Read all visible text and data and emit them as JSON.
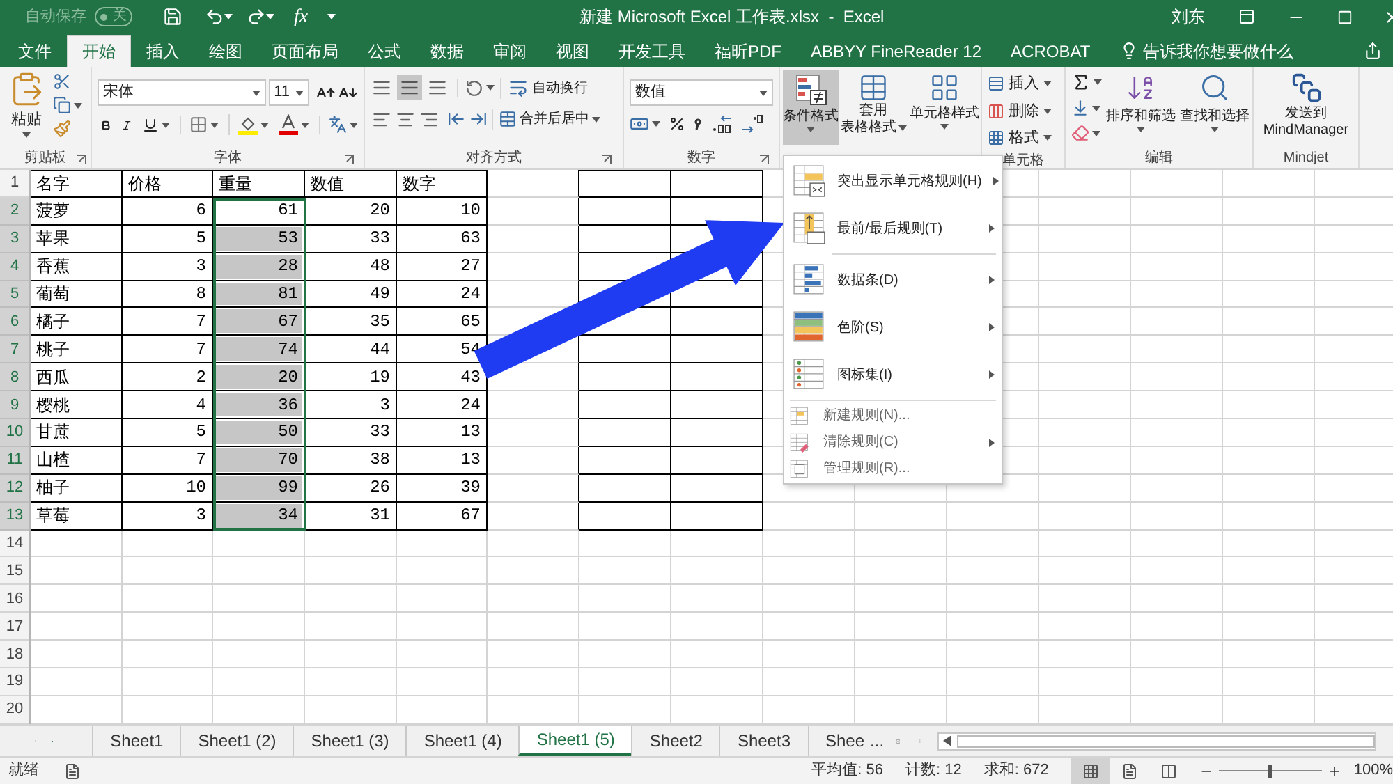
{
  "title_bar": {
    "autosave_label": "自动保存",
    "autosave_state": "关",
    "autosave_on": false,
    "fx": "fx",
    "title": "新建 Microsoft Excel 工作表.xlsx  -  Excel",
    "user": "刘东"
  },
  "ribbon_tabs": [
    {
      "label": "文件",
      "selected": false
    },
    {
      "label": "开始",
      "selected": true
    },
    {
      "label": "插入",
      "selected": false
    },
    {
      "label": "绘图",
      "selected": false
    },
    {
      "label": "页面布局",
      "selected": false
    },
    {
      "label": "公式",
      "selected": false
    },
    {
      "label": "数据",
      "selected": false
    },
    {
      "label": "审阅",
      "selected": false
    },
    {
      "label": "视图",
      "selected": false
    },
    {
      "label": "开发工具",
      "selected": false
    },
    {
      "label": "福昕PDF",
      "selected": false
    },
    {
      "label": "ABBYY FineReader 12",
      "selected": false
    },
    {
      "label": "ACROBAT",
      "selected": false
    }
  ],
  "tell_me": "告诉我你想要做什么",
  "ribbon": {
    "clipboard": {
      "paste": "粘贴",
      "group": "剪贴板"
    },
    "font": {
      "name": "宋体",
      "size": "11",
      "group": "字体"
    },
    "alignment": {
      "wrap": "自动换行",
      "merge": "合并后居中",
      "group": "对齐方式"
    },
    "number": {
      "format": "数值",
      "group": "数字"
    },
    "styles": {
      "conditional": "条件格式",
      "conditional_pressed": true,
      "table_1": "套用",
      "table_2": "表格格式",
      "cell_styles": "单元格样式"
    },
    "cells": {
      "insert": "插入",
      "delete": "删除",
      "format": "格式",
      "group": "单元格"
    },
    "editing": {
      "sort": "排序和筛选",
      "find": "查找和选择",
      "group": "编辑"
    },
    "mindjet": {
      "send_1": "发送到",
      "send_2": "MindManager",
      "group": "Mindjet"
    }
  },
  "row_headers": [
    {
      "label": "1",
      "selected": false
    },
    {
      "label": "2",
      "selected": true
    },
    {
      "label": "3",
      "selected": true
    },
    {
      "label": "4",
      "selected": true
    },
    {
      "label": "5",
      "selected": true
    },
    {
      "label": "6",
      "selected": true
    },
    {
      "label": "7",
      "selected": true
    },
    {
      "label": "8",
      "selected": true
    },
    {
      "label": "9",
      "selected": true
    },
    {
      "label": "10",
      "selected": true
    },
    {
      "label": "11",
      "selected": true
    },
    {
      "label": "12",
      "selected": true
    },
    {
      "label": "13",
      "selected": true
    },
    {
      "label": "14",
      "selected": false
    },
    {
      "label": "15",
      "selected": false
    },
    {
      "label": "16",
      "selected": false
    },
    {
      "label": "17",
      "selected": false
    },
    {
      "label": "18",
      "selected": false
    },
    {
      "label": "19",
      "selected": false
    },
    {
      "label": "20",
      "selected": false
    }
  ],
  "table": {
    "columns": [
      "名字",
      "价格",
      "重量",
      "数值",
      "数字"
    ],
    "rows": [
      {
        "cells": [
          "菠萝",
          "6",
          "61",
          "20",
          "10"
        ],
        "shaded": false
      },
      {
        "cells": [
          "苹果",
          "5",
          "53",
          "33",
          "63"
        ],
        "shaded": true
      },
      {
        "cells": [
          "香蕉",
          "3",
          "28",
          "48",
          "27"
        ],
        "shaded": true
      },
      {
        "cells": [
          "葡萄",
          "8",
          "81",
          "49",
          "24"
        ],
        "shaded": true
      },
      {
        "cells": [
          "橘子",
          "7",
          "67",
          "35",
          "65"
        ],
        "shaded": true
      },
      {
        "cells": [
          "桃子",
          "7",
          "74",
          "44",
          "54"
        ],
        "shaded": true
      },
      {
        "cells": [
          "西瓜",
          "2",
          "20",
          "19",
          "43"
        ],
        "shaded": true
      },
      {
        "cells": [
          "樱桃",
          "4",
          "36",
          "3",
          "24"
        ],
        "shaded": true
      },
      {
        "cells": [
          "甘蔗",
          "5",
          "50",
          "33",
          "13"
        ],
        "shaded": true
      },
      {
        "cells": [
          "山楂",
          "7",
          "70",
          "38",
          "13"
        ],
        "shaded": true
      },
      {
        "cells": [
          "柚子",
          "10",
          "99",
          "26",
          "39"
        ],
        "shaded": true
      },
      {
        "cells": [
          "草莓",
          "3",
          "34",
          "31",
          "67"
        ],
        "shaded": true
      }
    ]
  },
  "menu": {
    "items": [
      {
        "kind": "large",
        "label": "突出显示单元格规则(H)",
        "submenu": true,
        "separator_before": false
      },
      {
        "kind": "large",
        "label": "最前/最后规则(T)",
        "submenu": true,
        "separator_before": false
      },
      {
        "kind": "large",
        "label": "数据条(D)",
        "submenu": true,
        "separator_before": true
      },
      {
        "kind": "large",
        "label": "色阶(S)",
        "submenu": true,
        "separator_before": false
      },
      {
        "kind": "large",
        "label": "图标集(I)",
        "submenu": true,
        "separator_before": false
      },
      {
        "kind": "small",
        "label": "新建规则(N)...",
        "submenu": false,
        "separator_before": true
      },
      {
        "kind": "small",
        "label": "清除规则(C)",
        "submenu": true,
        "separator_before": false
      },
      {
        "kind": "small",
        "label": "管理规则(R)...",
        "submenu": false,
        "separator_before": false
      }
    ]
  },
  "sheet_tabs": [
    {
      "label": "Sheet1",
      "selected": false
    },
    {
      "label": "Sheet1 (2)",
      "selected": false
    },
    {
      "label": "Sheet1 (3)",
      "selected": false
    },
    {
      "label": "Sheet1 (4)",
      "selected": false
    },
    {
      "label": "Sheet1 (5)",
      "selected": true
    },
    {
      "label": "Sheet2",
      "selected": false
    },
    {
      "label": "Sheet3",
      "selected": false
    },
    {
      "label": "Shee",
      "selected": false
    }
  ],
  "more_tabs": "...",
  "status_bar": {
    "ready": "就绪",
    "average": "平均值: 56",
    "count": "计数: 12",
    "sum": "求和: 672",
    "views": [
      {
        "selected": true
      },
      {
        "selected": false
      },
      {
        "selected": false
      }
    ],
    "zoom_slider": {
      "level": 0.5
    },
    "zoom": "100%"
  }
}
